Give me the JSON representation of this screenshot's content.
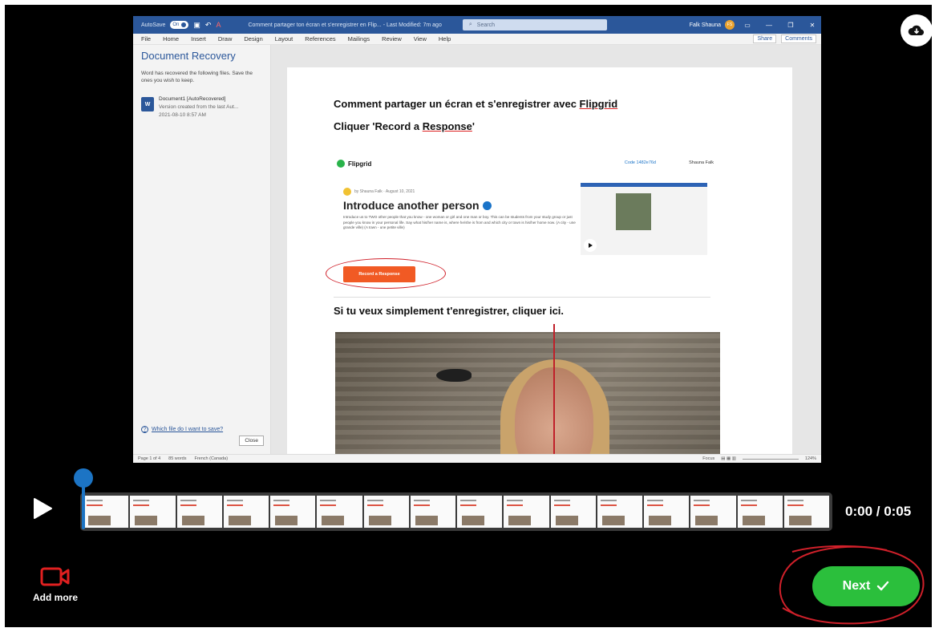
{
  "word": {
    "autosave_label": "AutoSave",
    "autosave_state": "On",
    "doc_title": "Comment partager ton écran et s'enregistrer en Flip...  -  Last Modified: 7m ago",
    "search_placeholder": "Search",
    "user_name": "Falk Shauna",
    "user_initials": "FS",
    "menu": [
      "File",
      "Home",
      "Insert",
      "Draw",
      "Design",
      "Layout",
      "References",
      "Mailings",
      "Review",
      "View",
      "Help"
    ],
    "share_label": "Share",
    "comments_label": "Comments",
    "recovery": {
      "title": "Document Recovery",
      "description": "Word has recovered the following files. Save the ones you wish to keep.",
      "file_name": "Document1  [AutoRecovered]",
      "file_detail": "Version created from the last Aut...",
      "file_date": "2021-08-10 8:57 AM",
      "help_link": "Which file do I want to save?",
      "close_label": "Close"
    },
    "document": {
      "heading1": "Comment partager un écran et s'enregistrer avec ",
      "heading1_u": "Flipgrid",
      "heading2": "Cliquer 'Record a ",
      "heading2_u": "Response",
      "heading2_end": "'",
      "heading3": "Si tu veux simplement t'enregistrer, cliquer ici."
    },
    "flipgrid": {
      "logo": "Flipgrid",
      "code": "Code 1482e76d",
      "user": "Shauna Falk",
      "byline": "by Shauna Falk · August 10, 2021",
      "heading": "Introduce another person",
      "description": "Introduce us to TWO other people that you know - one woman or girl and one man or boy. This can be students from your study group or just people you know in your personal life. Say what his/her name is, where he/she is from and which city or town is his/her home now. (A city - une grande ville) (A town - une petite ville)",
      "record_label": "Record a Response"
    },
    "status": {
      "page": "Page 1 of 4",
      "words": "85 words",
      "language": "French (Canada)",
      "focus": "Focus",
      "zoom": "124%"
    }
  },
  "player": {
    "time": "0:00 / 0:05",
    "frame_count": 16
  },
  "actions": {
    "add_more_label": "Add more",
    "next_label": "Next"
  },
  "colors": {
    "next": "#2bbf3c",
    "scrubber": "#1c74c4",
    "add_more_icon": "#e02020",
    "annotation": "#d0202a"
  }
}
